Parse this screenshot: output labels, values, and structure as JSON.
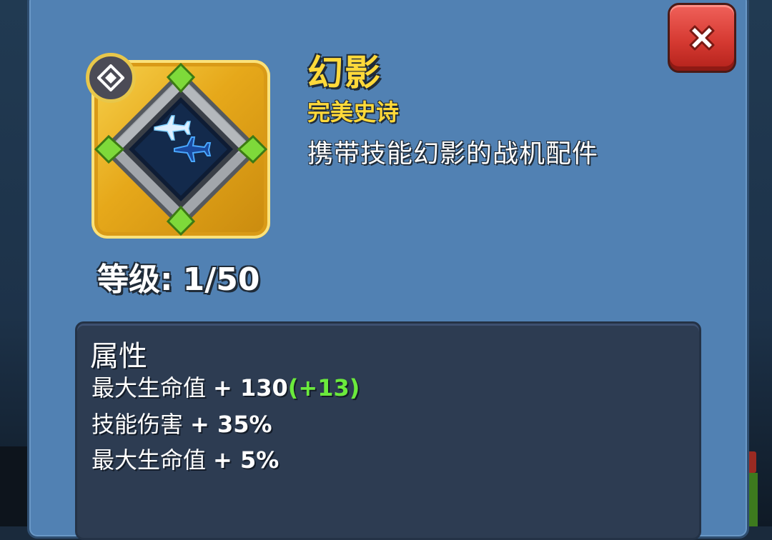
{
  "item": {
    "name": "幻影",
    "rarity": "完美史诗",
    "description": "携带技能幻影的战机配件",
    "icon": "fighter-jet-component-icon",
    "rarity_badge_icon": "diamond-icon"
  },
  "level": {
    "label": "等级:",
    "value": "1/50",
    "current": 1,
    "max": 50
  },
  "attributes": {
    "title": "属性",
    "lines": [
      {
        "name": "最大生命值",
        "value": "+ 130",
        "bonus": "(+13)"
      },
      {
        "name": "技能伤害",
        "value": "+ 35%",
        "bonus": ""
      },
      {
        "name": "最大生命值",
        "value": "+ 5%",
        "bonus": ""
      }
    ]
  },
  "close": {
    "icon": "close-icon"
  },
  "colors": {
    "panel": "#5181b3",
    "title_gold": "#ffd93a",
    "bonus_green": "#6bea3c",
    "close_red": "#d63a32"
  }
}
